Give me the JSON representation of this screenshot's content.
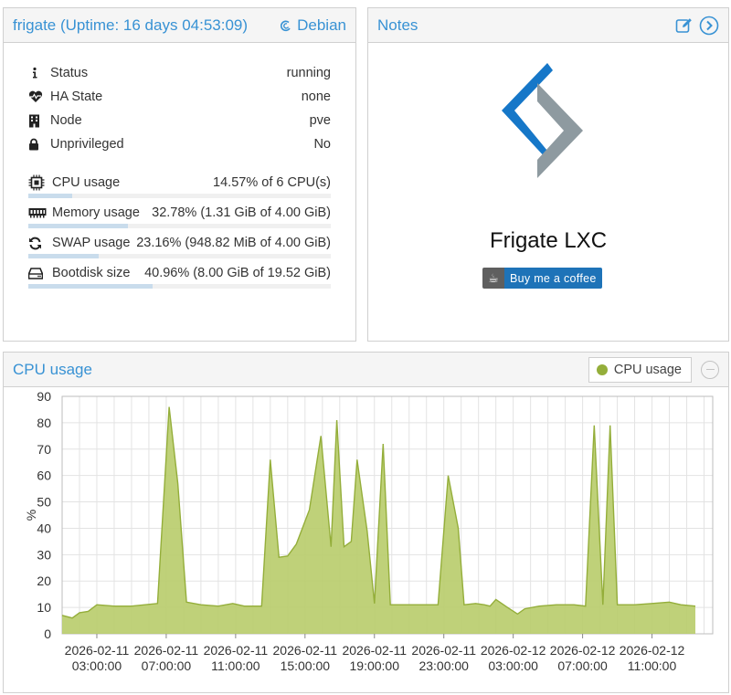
{
  "status": {
    "title": "frigate (Uptime: 16 days 04:53:09)",
    "os": "Debian",
    "rows": [
      {
        "icon": "info-icon",
        "label": "Status",
        "value": "running"
      },
      {
        "icon": "heartbeat-icon",
        "label": "HA State",
        "value": "none"
      },
      {
        "icon": "building-icon",
        "label": "Node",
        "value": "pve"
      },
      {
        "icon": "lock-icon",
        "label": "Unprivileged",
        "value": "No"
      }
    ],
    "usage": [
      {
        "icon": "cpu-icon",
        "label": "CPU usage",
        "value": "14.57% of 6 CPU(s)",
        "percent": 14.57
      },
      {
        "icon": "memory-icon",
        "label": "Memory usage",
        "value": "32.78% (1.31 GiB of 4.00 GiB)",
        "percent": 32.78
      },
      {
        "icon": "refresh-icon",
        "label": "SWAP usage",
        "value": "23.16% (948.82 MiB of 4.00 GiB)",
        "percent": 23.16
      },
      {
        "icon": "hdd-icon",
        "label": "Bootdisk size",
        "value": "40.96% (8.00 GiB of 19.52 GiB)",
        "percent": 40.96
      }
    ]
  },
  "notes": {
    "title": "Notes",
    "heading": "Frigate LXC",
    "coffee_label": "Buy me a coffee",
    "colors": {
      "logo_blue": "#1677c8",
      "logo_grey": "#8e9aa0",
      "button_blue": "#1e73b8"
    }
  },
  "chart_panel": {
    "title": "CPU usage",
    "legend_label": "CPU usage"
  },
  "chart_data": {
    "type": "area",
    "ylabel": "%",
    "ylim": [
      0,
      90
    ],
    "yticks": [
      0,
      10,
      20,
      30,
      40,
      50,
      60,
      70,
      80,
      90
    ],
    "xlim": [
      "2026-02-11 01:00:00",
      "2026-02-12 14:30:00"
    ],
    "xticks": [
      {
        "date": "2026-02-11",
        "time": "03:00:00"
      },
      {
        "date": "2026-02-11",
        "time": "07:00:00"
      },
      {
        "date": "2026-02-11",
        "time": "11:00:00"
      },
      {
        "date": "2026-02-11",
        "time": "15:00:00"
      },
      {
        "date": "2026-02-11",
        "time": "19:00:00"
      },
      {
        "date": "2026-02-11",
        "time": "23:00:00"
      },
      {
        "date": "2026-02-12",
        "time": "03:00:00"
      },
      {
        "date": "2026-02-12",
        "time": "07:00:00"
      },
      {
        "date": "2026-02-12",
        "time": "11:00:00"
      }
    ],
    "grid": true,
    "legend": "top-right",
    "color": "#94ae3a",
    "series": [
      {
        "name": "CPU usage",
        "points": [
          [
            "2026-02-11 01:00",
            7
          ],
          [
            "2026-02-11 01:35",
            6
          ],
          [
            "2026-02-11 02:00",
            8
          ],
          [
            "2026-02-11 02:30",
            8.5
          ],
          [
            "2026-02-11 03:00",
            11
          ],
          [
            "2026-02-11 04:00",
            10.5
          ],
          [
            "2026-02-11 05:00",
            10.5
          ],
          [
            "2026-02-11 06:30",
            11.5
          ],
          [
            "2026-02-11 07:10",
            86
          ],
          [
            "2026-02-11 07:40",
            57
          ],
          [
            "2026-02-11 08:10",
            12
          ],
          [
            "2026-02-11 09:00",
            11
          ],
          [
            "2026-02-11 10:00",
            10.5
          ],
          [
            "2026-02-11 10:50",
            11.5
          ],
          [
            "2026-02-11 11:30",
            10.5
          ],
          [
            "2026-02-11 12:30",
            10.5
          ],
          [
            "2026-02-11 13:00",
            66
          ],
          [
            "2026-02-11 13:30",
            29
          ],
          [
            "2026-02-11 14:00",
            29.5
          ],
          [
            "2026-02-11 14:30",
            34
          ],
          [
            "2026-02-11 15:15",
            47
          ],
          [
            "2026-02-11 15:55",
            75
          ],
          [
            "2026-02-11 16:30",
            33
          ],
          [
            "2026-02-11 16:50",
            81
          ],
          [
            "2026-02-11 17:15",
            33
          ],
          [
            "2026-02-11 17:40",
            35
          ],
          [
            "2026-02-11 18:00",
            66
          ],
          [
            "2026-02-11 18:35",
            39
          ],
          [
            "2026-02-11 19:00",
            11.5
          ],
          [
            "2026-02-11 19:30",
            72
          ],
          [
            "2026-02-11 19:55",
            11
          ],
          [
            "2026-02-11 21:00",
            11
          ],
          [
            "2026-02-11 22:40",
            11
          ],
          [
            "2026-02-11 23:15",
            60
          ],
          [
            "2026-02-11 23:50",
            40
          ],
          [
            "2026-02-12 00:10",
            11
          ],
          [
            "2026-02-12 00:50",
            11.5
          ],
          [
            "2026-02-12 01:20",
            11
          ],
          [
            "2026-02-12 01:40",
            10.5
          ],
          [
            "2026-02-12 02:00",
            13
          ],
          [
            "2026-02-12 02:40",
            10
          ],
          [
            "2026-02-12 03:15",
            7.5
          ],
          [
            "2026-02-12 03:40",
            9.5
          ],
          [
            "2026-02-12 04:30",
            10.5
          ],
          [
            "2026-02-12 05:30",
            11
          ],
          [
            "2026-02-12 06:30",
            11
          ],
          [
            "2026-02-12 07:10",
            10.5
          ],
          [
            "2026-02-12 07:40",
            79
          ],
          [
            "2026-02-12 08:10",
            11
          ],
          [
            "2026-02-12 08:35",
            79
          ],
          [
            "2026-02-12 09:00",
            11
          ],
          [
            "2026-02-12 10:00",
            11
          ],
          [
            "2026-02-12 11:00",
            11.5
          ],
          [
            "2026-02-12 12:00",
            12
          ],
          [
            "2026-02-12 12:40",
            11
          ],
          [
            "2026-02-12 13:30",
            10.5
          ]
        ]
      }
    ]
  }
}
